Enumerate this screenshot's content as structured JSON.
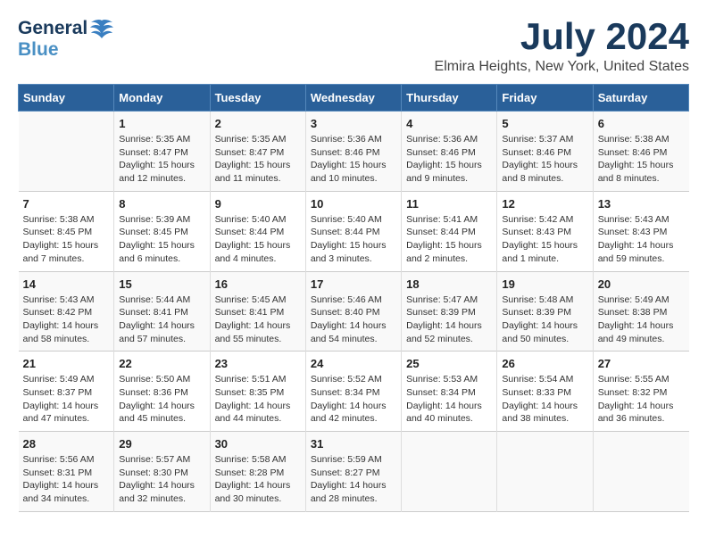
{
  "header": {
    "logo_general": "General",
    "logo_blue": "Blue",
    "month_title": "July 2024",
    "location": "Elmira Heights, New York, United States"
  },
  "columns": [
    "Sunday",
    "Monday",
    "Tuesday",
    "Wednesday",
    "Thursday",
    "Friday",
    "Saturday"
  ],
  "weeks": [
    [
      {
        "day": "",
        "sunrise": "",
        "sunset": "",
        "daylight": ""
      },
      {
        "day": "1",
        "sunrise": "Sunrise: 5:35 AM",
        "sunset": "Sunset: 8:47 PM",
        "daylight": "Daylight: 15 hours and 12 minutes."
      },
      {
        "day": "2",
        "sunrise": "Sunrise: 5:35 AM",
        "sunset": "Sunset: 8:47 PM",
        "daylight": "Daylight: 15 hours and 11 minutes."
      },
      {
        "day": "3",
        "sunrise": "Sunrise: 5:36 AM",
        "sunset": "Sunset: 8:46 PM",
        "daylight": "Daylight: 15 hours and 10 minutes."
      },
      {
        "day": "4",
        "sunrise": "Sunrise: 5:36 AM",
        "sunset": "Sunset: 8:46 PM",
        "daylight": "Daylight: 15 hours and 9 minutes."
      },
      {
        "day": "5",
        "sunrise": "Sunrise: 5:37 AM",
        "sunset": "Sunset: 8:46 PM",
        "daylight": "Daylight: 15 hours and 8 minutes."
      },
      {
        "day": "6",
        "sunrise": "Sunrise: 5:38 AM",
        "sunset": "Sunset: 8:46 PM",
        "daylight": "Daylight: 15 hours and 8 minutes."
      }
    ],
    [
      {
        "day": "7",
        "sunrise": "Sunrise: 5:38 AM",
        "sunset": "Sunset: 8:45 PM",
        "daylight": "Daylight: 15 hours and 7 minutes."
      },
      {
        "day": "8",
        "sunrise": "Sunrise: 5:39 AM",
        "sunset": "Sunset: 8:45 PM",
        "daylight": "Daylight: 15 hours and 6 minutes."
      },
      {
        "day": "9",
        "sunrise": "Sunrise: 5:40 AM",
        "sunset": "Sunset: 8:44 PM",
        "daylight": "Daylight: 15 hours and 4 minutes."
      },
      {
        "day": "10",
        "sunrise": "Sunrise: 5:40 AM",
        "sunset": "Sunset: 8:44 PM",
        "daylight": "Daylight: 15 hours and 3 minutes."
      },
      {
        "day": "11",
        "sunrise": "Sunrise: 5:41 AM",
        "sunset": "Sunset: 8:44 PM",
        "daylight": "Daylight: 15 hours and 2 minutes."
      },
      {
        "day": "12",
        "sunrise": "Sunrise: 5:42 AM",
        "sunset": "Sunset: 8:43 PM",
        "daylight": "Daylight: 15 hours and 1 minute."
      },
      {
        "day": "13",
        "sunrise": "Sunrise: 5:43 AM",
        "sunset": "Sunset: 8:43 PM",
        "daylight": "Daylight: 14 hours and 59 minutes."
      }
    ],
    [
      {
        "day": "14",
        "sunrise": "Sunrise: 5:43 AM",
        "sunset": "Sunset: 8:42 PM",
        "daylight": "Daylight: 14 hours and 58 minutes."
      },
      {
        "day": "15",
        "sunrise": "Sunrise: 5:44 AM",
        "sunset": "Sunset: 8:41 PM",
        "daylight": "Daylight: 14 hours and 57 minutes."
      },
      {
        "day": "16",
        "sunrise": "Sunrise: 5:45 AM",
        "sunset": "Sunset: 8:41 PM",
        "daylight": "Daylight: 14 hours and 55 minutes."
      },
      {
        "day": "17",
        "sunrise": "Sunrise: 5:46 AM",
        "sunset": "Sunset: 8:40 PM",
        "daylight": "Daylight: 14 hours and 54 minutes."
      },
      {
        "day": "18",
        "sunrise": "Sunrise: 5:47 AM",
        "sunset": "Sunset: 8:39 PM",
        "daylight": "Daylight: 14 hours and 52 minutes."
      },
      {
        "day": "19",
        "sunrise": "Sunrise: 5:48 AM",
        "sunset": "Sunset: 8:39 PM",
        "daylight": "Daylight: 14 hours and 50 minutes."
      },
      {
        "day": "20",
        "sunrise": "Sunrise: 5:49 AM",
        "sunset": "Sunset: 8:38 PM",
        "daylight": "Daylight: 14 hours and 49 minutes."
      }
    ],
    [
      {
        "day": "21",
        "sunrise": "Sunrise: 5:49 AM",
        "sunset": "Sunset: 8:37 PM",
        "daylight": "Daylight: 14 hours and 47 minutes."
      },
      {
        "day": "22",
        "sunrise": "Sunrise: 5:50 AM",
        "sunset": "Sunset: 8:36 PM",
        "daylight": "Daylight: 14 hours and 45 minutes."
      },
      {
        "day": "23",
        "sunrise": "Sunrise: 5:51 AM",
        "sunset": "Sunset: 8:35 PM",
        "daylight": "Daylight: 14 hours and 44 minutes."
      },
      {
        "day": "24",
        "sunrise": "Sunrise: 5:52 AM",
        "sunset": "Sunset: 8:34 PM",
        "daylight": "Daylight: 14 hours and 42 minutes."
      },
      {
        "day": "25",
        "sunrise": "Sunrise: 5:53 AM",
        "sunset": "Sunset: 8:34 PM",
        "daylight": "Daylight: 14 hours and 40 minutes."
      },
      {
        "day": "26",
        "sunrise": "Sunrise: 5:54 AM",
        "sunset": "Sunset: 8:33 PM",
        "daylight": "Daylight: 14 hours and 38 minutes."
      },
      {
        "day": "27",
        "sunrise": "Sunrise: 5:55 AM",
        "sunset": "Sunset: 8:32 PM",
        "daylight": "Daylight: 14 hours and 36 minutes."
      }
    ],
    [
      {
        "day": "28",
        "sunrise": "Sunrise: 5:56 AM",
        "sunset": "Sunset: 8:31 PM",
        "daylight": "Daylight: 14 hours and 34 minutes."
      },
      {
        "day": "29",
        "sunrise": "Sunrise: 5:57 AM",
        "sunset": "Sunset: 8:30 PM",
        "daylight": "Daylight: 14 hours and 32 minutes."
      },
      {
        "day": "30",
        "sunrise": "Sunrise: 5:58 AM",
        "sunset": "Sunset: 8:28 PM",
        "daylight": "Daylight: 14 hours and 30 minutes."
      },
      {
        "day": "31",
        "sunrise": "Sunrise: 5:59 AM",
        "sunset": "Sunset: 8:27 PM",
        "daylight": "Daylight: 14 hours and 28 minutes."
      },
      {
        "day": "",
        "sunrise": "",
        "sunset": "",
        "daylight": ""
      },
      {
        "day": "",
        "sunrise": "",
        "sunset": "",
        "daylight": ""
      },
      {
        "day": "",
        "sunrise": "",
        "sunset": "",
        "daylight": ""
      }
    ]
  ]
}
